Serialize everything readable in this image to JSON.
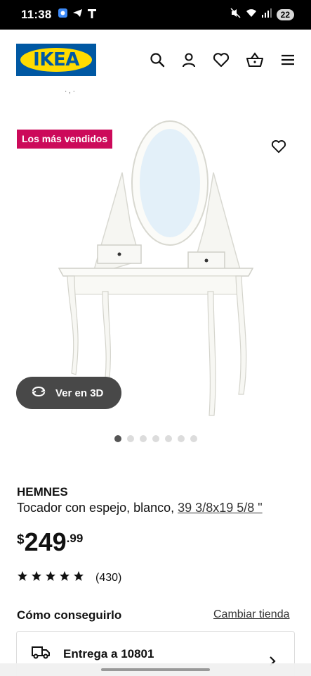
{
  "status_bar": {
    "time": "11:38",
    "battery": "22"
  },
  "brand": {
    "logo_text": "IKEA",
    "blue": "#0058a3",
    "yellow": "#ffdb00"
  },
  "header": {
    "icons": [
      "search-icon",
      "user-icon",
      "heart-icon",
      "basket-icon",
      "menu-icon"
    ]
  },
  "breadcrumb_fragment": "·    ,    ·",
  "product": {
    "badge": "Los más vendidos",
    "badge_color": "#cc0a5a",
    "view_3d_label": "Ver en 3D",
    "gallery_count": 7,
    "gallery_active_index": 0,
    "name": "HEMNES",
    "description": "Tocador con espejo, blanco, ",
    "size": "39 3/8x19 5/8 \"",
    "price": {
      "currency": "$",
      "integer": "249",
      "decimals": ".99"
    },
    "rating": {
      "stars": 5,
      "count": "(430)"
    }
  },
  "availability": {
    "title": "Cómo conseguirlo",
    "change_store": "Cambiar tienda",
    "delivery_label": "Entrega a 10801"
  }
}
